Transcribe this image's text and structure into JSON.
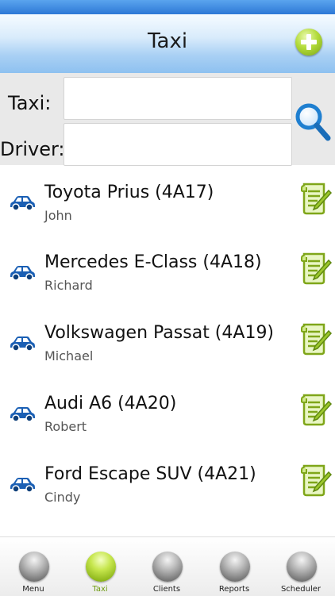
{
  "header": {
    "title": "Taxi",
    "add_icon": "plus-circle-icon"
  },
  "filter": {
    "taxi_label": "Taxi:",
    "taxi_value": "",
    "driver_label": "Driver:",
    "driver_value": "",
    "search_icon": "magnifier-icon"
  },
  "taxis": [
    {
      "name": "Toyota Prius (4A17)",
      "driver": "John"
    },
    {
      "name": "Mercedes E-Class (4A18)",
      "driver": "Richard"
    },
    {
      "name": "Volkswagen Passat (4A19)",
      "driver": "Michael"
    },
    {
      "name": "Audi A6 (4A20)",
      "driver": "Robert"
    },
    {
      "name": "Ford Escape SUV (4A21)",
      "driver": "Cindy"
    }
  ],
  "tabs": [
    {
      "label": "Menu",
      "active": false
    },
    {
      "label": "Taxi",
      "active": true
    },
    {
      "label": "Clients",
      "active": false
    },
    {
      "label": "Reports",
      "active": false
    },
    {
      "label": "Scheduler",
      "active": false
    }
  ],
  "colors": {
    "header_blue": "#8ec1f0",
    "accent_green": "#8fb71c",
    "car_blue": "#1a5fb4",
    "search_blue": "#1f7fd0"
  }
}
